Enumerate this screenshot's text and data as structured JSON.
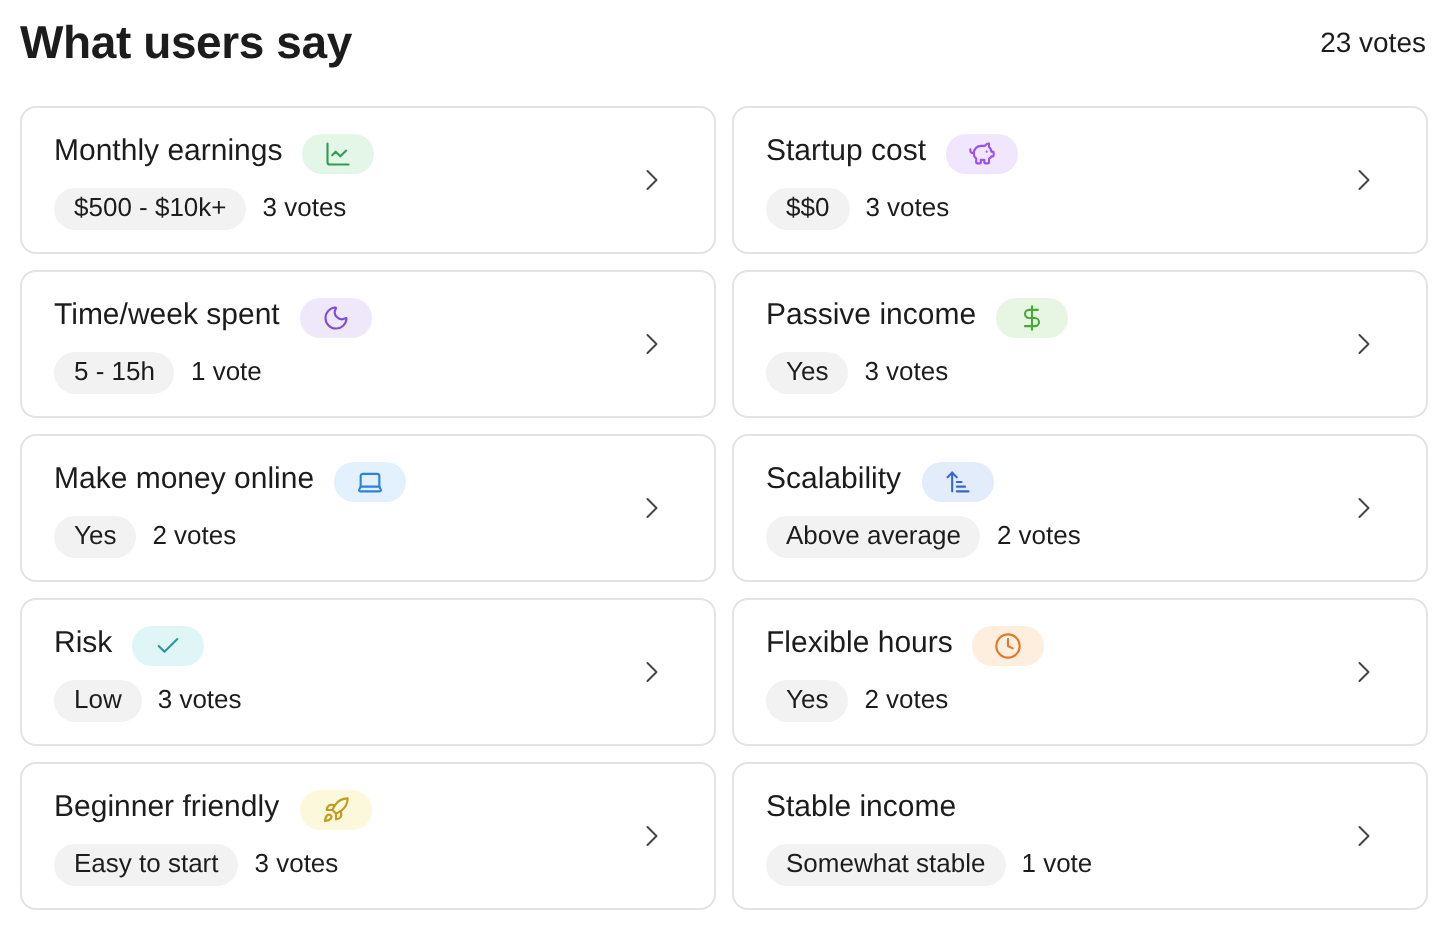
{
  "header": {
    "title": "What users say",
    "total_votes": "23 votes"
  },
  "cards": [
    {
      "label": "Monthly earnings",
      "kind": "chart",
      "answer": "$500 - $10k+",
      "votes": "3 votes"
    },
    {
      "label": "Startup cost",
      "kind": "piggy",
      "answer": "$$0",
      "votes": "3 votes"
    },
    {
      "label": "Time/week spent",
      "kind": "moon",
      "answer": "5 - 15h",
      "votes": "1 vote"
    },
    {
      "label": "Passive income",
      "kind": "dollar",
      "answer": "Yes",
      "votes": "3 votes"
    },
    {
      "label": "Make money online",
      "kind": "laptop",
      "answer": "Yes",
      "votes": "2 votes"
    },
    {
      "label": "Scalability",
      "kind": "sort",
      "answer": "Above average",
      "votes": "2 votes"
    },
    {
      "label": "Risk",
      "kind": "check",
      "answer": "Low",
      "votes": "3 votes"
    },
    {
      "label": "Flexible hours",
      "kind": "clock",
      "answer": "Yes",
      "votes": "2 votes"
    },
    {
      "label": "Beginner friendly",
      "kind": "rocket",
      "answer": "Easy to start",
      "votes": "3 votes"
    },
    {
      "label": "Stable income",
      "kind": "plain",
      "answer": "Somewhat stable",
      "votes": "1 vote"
    }
  ]
}
